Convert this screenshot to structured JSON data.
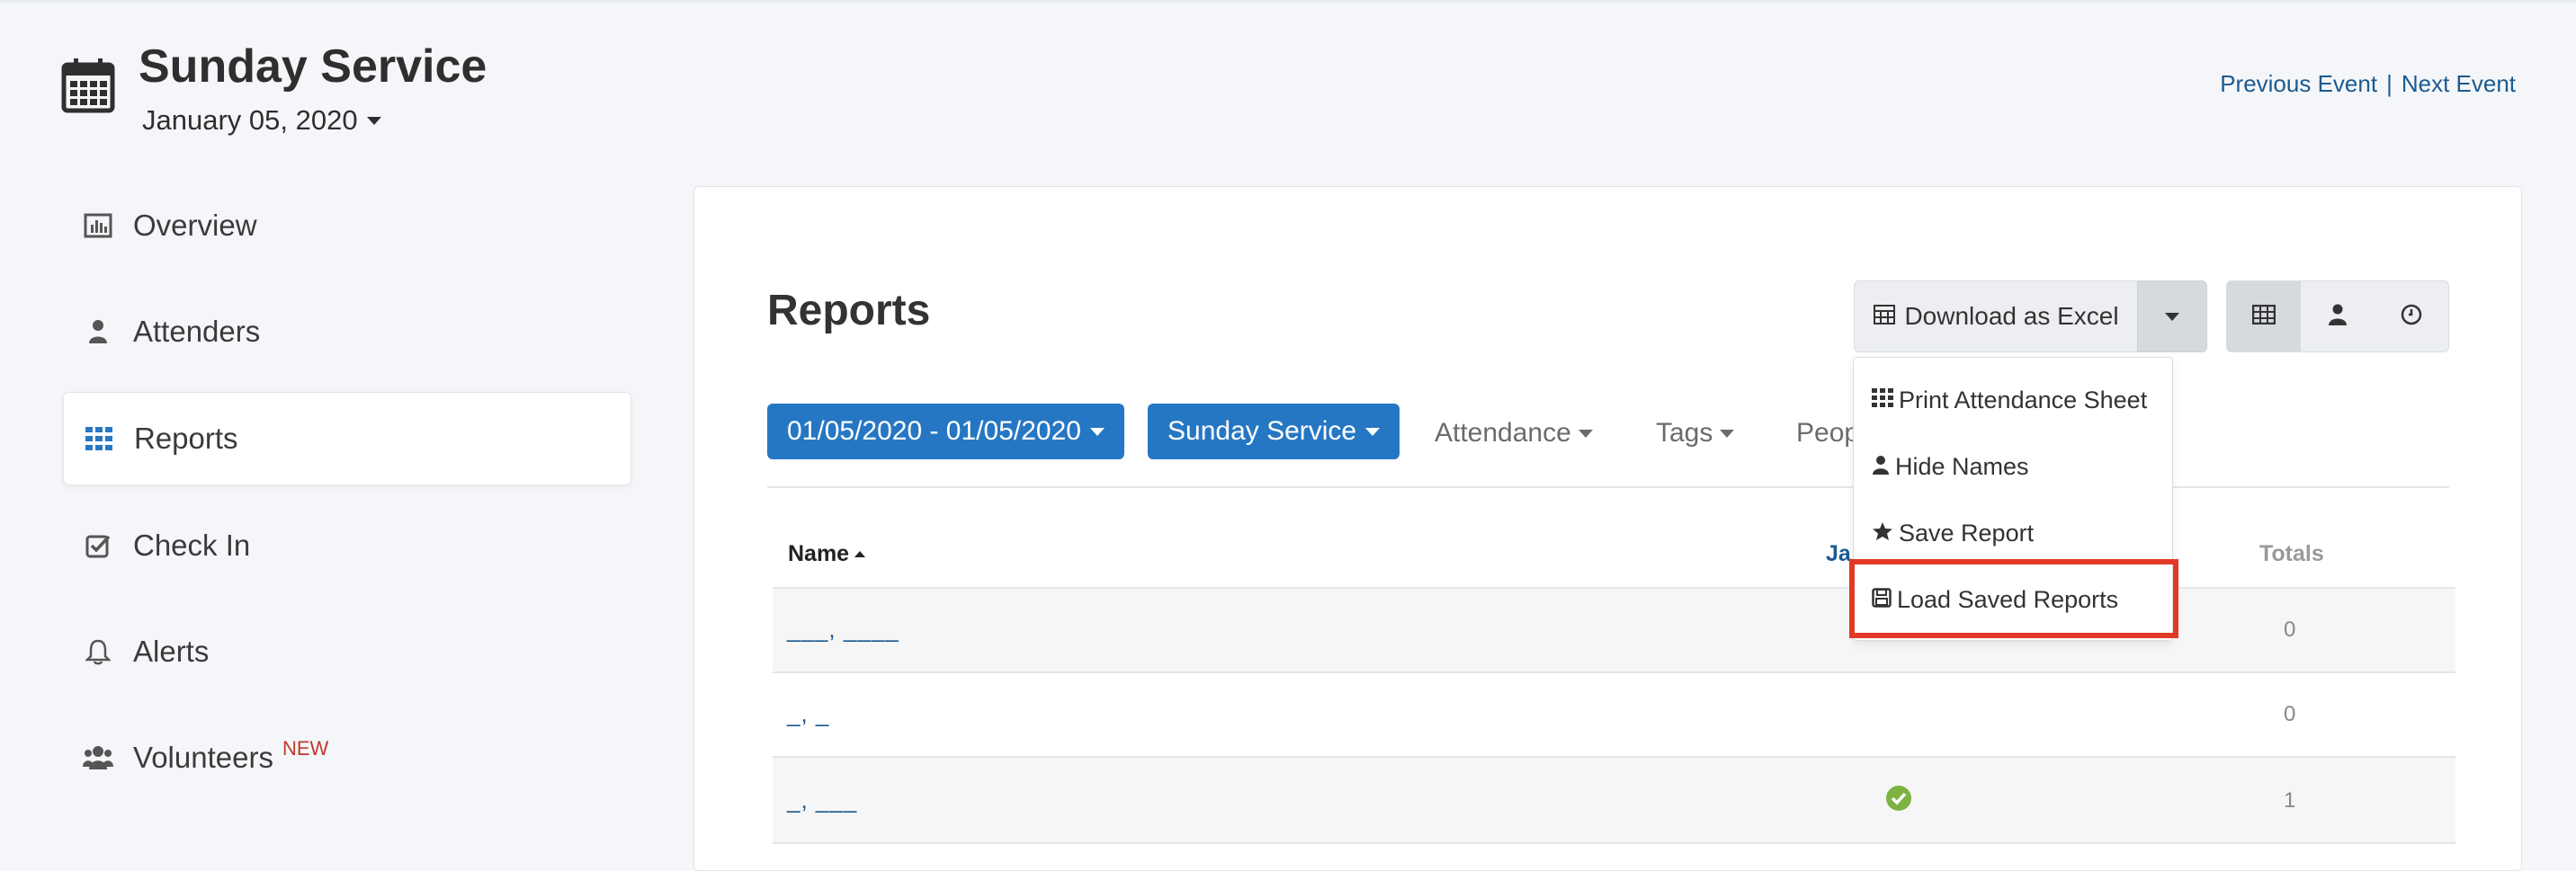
{
  "event": {
    "title": "Sunday Service",
    "date": "January 05, 2020",
    "previous_label": "Previous Event",
    "separator": "|",
    "next_label": "Next Event"
  },
  "sidebar": {
    "items": [
      {
        "label": "Overview",
        "icon": "bar-chart-icon"
      },
      {
        "label": "Attenders",
        "icon": "person-icon"
      },
      {
        "label": "Reports",
        "icon": "grid-icon",
        "active": true
      },
      {
        "label": "Check In",
        "icon": "checkbox-icon"
      },
      {
        "label": "Alerts",
        "icon": "bell-icon"
      },
      {
        "label": "Volunteers",
        "icon": "users-icon",
        "badge": "NEW"
      }
    ]
  },
  "reports": {
    "title": "Reports",
    "download_label": "Download as Excel",
    "filters": {
      "date_range": "01/05/2020 - 01/05/2020",
      "service": "Sunday Service",
      "attendance": "Attendance",
      "tags": "Tags",
      "people": "Peop"
    },
    "table": {
      "headers": {
        "name": "Name",
        "date_col": "Ja",
        "totals": "Totals"
      },
      "rows": [
        {
          "name": "___, ____",
          "attended": false,
          "total": "0"
        },
        {
          "name": "_, _",
          "attended": false,
          "total": "0"
        },
        {
          "name": "_, ___",
          "attended": true,
          "total": "1"
        }
      ]
    },
    "dropdown": {
      "items": [
        {
          "label": "Print Attendance Sheet",
          "icon": "grid-icon"
        },
        {
          "label": "Hide Names",
          "icon": "person-icon"
        },
        {
          "label": "Save Report",
          "icon": "star-icon"
        },
        {
          "label": "Load Saved Reports",
          "icon": "save-icon",
          "highlighted": true
        }
      ]
    }
  },
  "colors": {
    "primary": "#2677c3",
    "link": "#1c5a8f",
    "highlight": "#e03a26",
    "success": "#7cb342",
    "badge": "#c0392b"
  }
}
